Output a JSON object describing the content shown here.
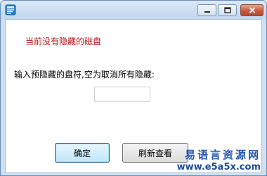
{
  "window": {
    "minimize_icon": "minimize-icon",
    "maximize_icon": "maximize-icon",
    "close_icon": "close-icon",
    "app_icon": "app-icon"
  },
  "status": {
    "text": "当前没有隐藏的磁盘",
    "color": "#b41212"
  },
  "prompt": {
    "text": "输入预隐藏的盘符,空为取消所有隐藏:"
  },
  "drive_input": {
    "value": "",
    "placeholder": ""
  },
  "buttons": {
    "ok_label": "确定",
    "refresh_label": "刷新查看"
  },
  "watermark": {
    "line1": "易语言资源网",
    "line2": "www.e5a5x.com"
  }
}
